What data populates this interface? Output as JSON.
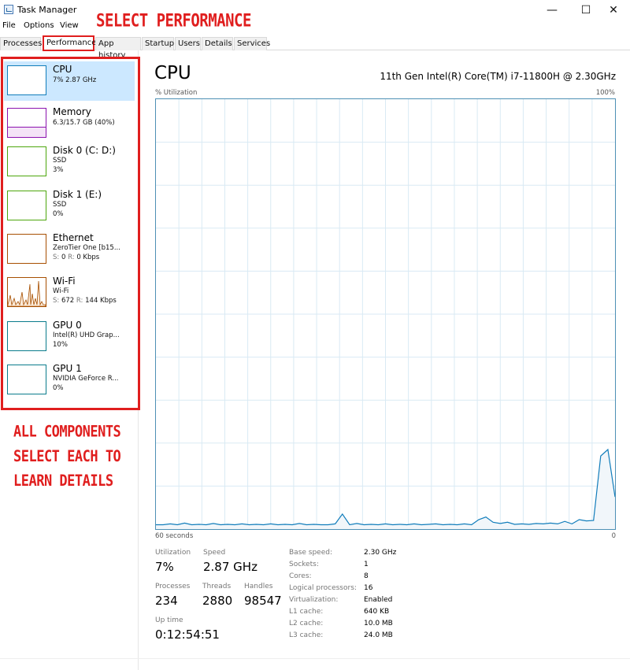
{
  "window": {
    "title": "Task Manager",
    "minimize": "—",
    "maximize": "☐",
    "close": "✕"
  },
  "menu": [
    "File",
    "Options",
    "View"
  ],
  "tabs": [
    "Processes",
    "Performance",
    "App history",
    "Startup",
    "Users",
    "Details",
    "Services"
  ],
  "annotations": {
    "top": "SELECT PERFORMANCE",
    "side_line1": "ALL COMPONENTS",
    "side_line2": "SELECT EACH TO",
    "side_line3": "LEARN DETAILS",
    "color": "#e01e1e"
  },
  "sidebar": [
    {
      "name": "CPU",
      "sub1": "7% 2.87 GHz",
      "sub2": "",
      "color": "#117dbb"
    },
    {
      "name": "Memory",
      "sub1": "6.3/15.7 GB (40%)",
      "sub2": "",
      "color": "#8b12ae"
    },
    {
      "name": "Disk 0 (C: D:)",
      "sub1": "SSD",
      "sub2": "3%",
      "color": "#4da60c"
    },
    {
      "name": "Disk 1 (E:)",
      "sub1": "SSD",
      "sub2": "0%",
      "color": "#4da60c"
    },
    {
      "name": "Ethernet",
      "sub1": "ZeroTier One [b15...",
      "s_label": "S:",
      "s_value": "0",
      "r_label": "R:",
      "r_value": "0 Kbps",
      "color": "#a74f01"
    },
    {
      "name": "Wi-Fi",
      "sub1": "Wi-Fi",
      "s_label": "S:",
      "s_value": "672",
      "r_label": "R:",
      "r_value": "144 Kbps",
      "color": "#a74f01"
    },
    {
      "name": "GPU 0",
      "sub1": "Intel(R) UHD Grap...",
      "sub2": "10%",
      "color": "#0a7c8c"
    },
    {
      "name": "GPU 1",
      "sub1": "NVIDIA GeForce R...",
      "sub2": "0%",
      "color": "#0a7c8c"
    }
  ],
  "main": {
    "title": "CPU",
    "model": "11th Gen Intel(R) Core(TM) i7-11800H @ 2.30GHz",
    "y_label": "% Utilization",
    "y_max": "100%",
    "x_left": "60 seconds",
    "x_right": "0",
    "line_color": "#117dbb",
    "fill_color": "#f1f6fa",
    "grid_color": "#d9eaf4"
  },
  "stats": {
    "utilization_label": "Utilization",
    "utilization": "7%",
    "speed_label": "Speed",
    "speed": "2.87 GHz",
    "processes_label": "Processes",
    "processes": "234",
    "threads_label": "Threads",
    "threads": "2880",
    "handles_label": "Handles",
    "handles": "98547",
    "uptime_label": "Up time",
    "uptime": "0:12:54:51"
  },
  "info": [
    {
      "label": "Base speed:",
      "value": "2.30 GHz"
    },
    {
      "label": "Sockets:",
      "value": "1"
    },
    {
      "label": "Cores:",
      "value": "8"
    },
    {
      "label": "Logical processors:",
      "value": "16"
    },
    {
      "label": "Virtualization:",
      "value": "Enabled"
    },
    {
      "label": "L1 cache:",
      "value": "640 KB"
    },
    {
      "label": "L2 cache:",
      "value": "10.0 MB"
    },
    {
      "label": "L3 cache:",
      "value": "24.0 MB"
    }
  ],
  "chart_data": {
    "type": "area",
    "title": "CPU",
    "ylabel": "% Utilization",
    "xlabel": "60 seconds",
    "xlim": [
      60,
      0
    ],
    "ylim": [
      0,
      100
    ],
    "grid": true,
    "series": [
      {
        "values": [
          1,
          1,
          1.2,
          1,
          1.4,
          1,
          1.1,
          1,
          1.3,
          1,
          1.1,
          1,
          1.2,
          1,
          1.1,
          1,
          1.2,
          1,
          1.1,
          1,
          1.3,
          1,
          1.1,
          1,
          1,
          1.2,
          3.5,
          1,
          1.3,
          1,
          1.1,
          1,
          1.2,
          1,
          1.1,
          1,
          1.2,
          1,
          1.1,
          1.2,
          1,
          1.1,
          1,
          1.2,
          1,
          2.2,
          2.8,
          1.6,
          1.3,
          1.6,
          1.1,
          1.2,
          1.1,
          1.3,
          1.2,
          1.4,
          1.2,
          1.8,
          1.2,
          2.2,
          1.9,
          2,
          17,
          18.5,
          7.5
        ]
      }
    ]
  }
}
